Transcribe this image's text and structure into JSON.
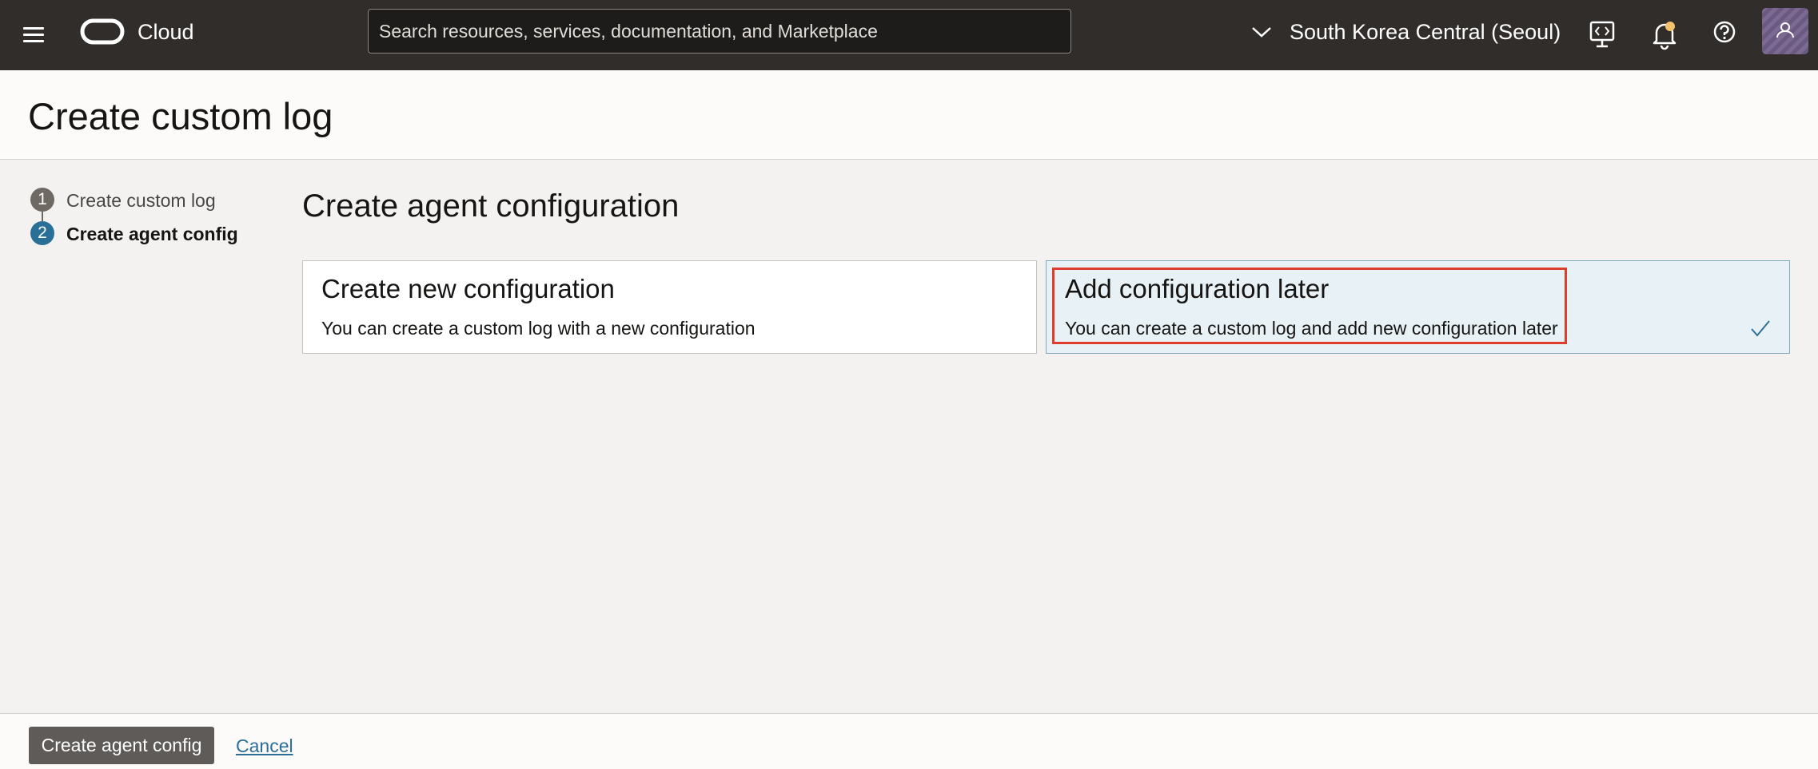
{
  "topbar": {
    "brand": "Cloud",
    "search_placeholder": "Search resources, services, documentation, and Marketplace",
    "region": "South Korea Central (Seoul)",
    "icons": [
      "menu-icon",
      "oracle-logo",
      "chevron-down-icon",
      "developer-tools-icon",
      "bell-icon",
      "help-icon",
      "avatar"
    ]
  },
  "page": {
    "title": "Create custom log"
  },
  "steps": [
    {
      "number": "1",
      "label": "Create custom log",
      "state": "completed"
    },
    {
      "number": "2",
      "label": "Create agent config",
      "state": "current"
    }
  ],
  "main": {
    "section_title": "Create agent configuration",
    "options": [
      {
        "title": "Create new configuration",
        "description": "You can create a custom log with a new configuration",
        "selected": false
      },
      {
        "title": "Add configuration later",
        "description": "You can create a custom log and add new configuration later",
        "selected": true
      }
    ]
  },
  "footer": {
    "primary_label": "Create agent config",
    "cancel_label": "Cancel"
  },
  "colors": {
    "topbar_bg": "#312d2a",
    "selected_card_bg": "#e8f2f6",
    "highlight_border": "#e03e2d",
    "link": "#2a6f97",
    "step_current": "#2a6f97",
    "step_completed": "#6f6964"
  }
}
